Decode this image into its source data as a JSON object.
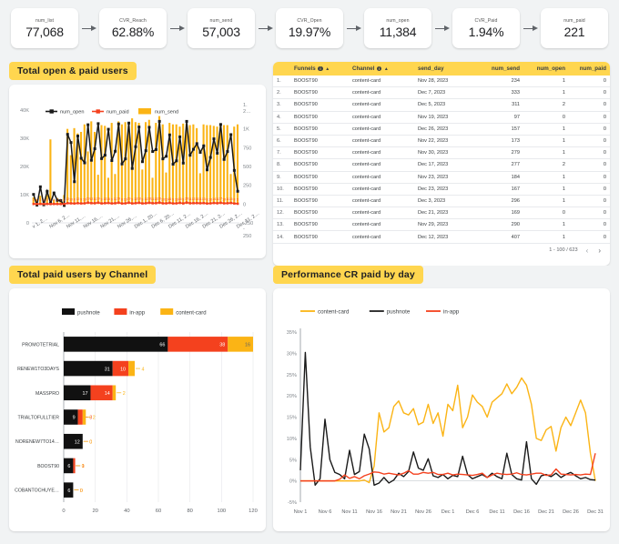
{
  "funnel": {
    "steps": [
      {
        "label": "num_list",
        "value": "77,068"
      },
      {
        "label": "CVR_Reach",
        "value": "62.88%"
      },
      {
        "label": "num_send",
        "value": "57,003"
      },
      {
        "label": "CVR_Open",
        "value": "19.97%"
      },
      {
        "label": "num_open",
        "value": "11,384"
      },
      {
        "label": "CVR_Paid",
        "value": "1.94%"
      },
      {
        "label": "num_paid",
        "value": "221"
      }
    ]
  },
  "panels": {
    "open_paid_title": "Total open & paid users",
    "channel_title": "Total paid users by Channel",
    "cr_title": "Performance CR paid by day"
  },
  "colors": {
    "accent_yellow": "#ffd64f",
    "bar_orange": "#fbb415",
    "line_black": "#1a1a1a",
    "line_red": "#f4411e",
    "in_app": "#f4411e",
    "content_card": "#fbb415",
    "pushnote": "#111111",
    "panel_bg": "#f1f3f4"
  },
  "table": {
    "columns": [
      {
        "key": "idx",
        "label": ""
      },
      {
        "key": "funnels",
        "label": "Funnels",
        "info": true,
        "sort": "▲"
      },
      {
        "key": "channel",
        "label": "Channel",
        "info": true,
        "sort": "▲"
      },
      {
        "key": "send_day",
        "label": "send_day"
      },
      {
        "key": "num_send",
        "label": "num_send"
      },
      {
        "key": "num_open",
        "label": "num_open"
      },
      {
        "key": "num_paid",
        "label": "num_paid"
      }
    ],
    "rows": [
      {
        "idx": "1.",
        "funnels": "BOOST90",
        "channel": "content-card",
        "send_day": "Nov 28, 2023",
        "num_send": "234",
        "num_open": "1",
        "num_paid": "0"
      },
      {
        "idx": "2.",
        "funnels": "BOOST90",
        "channel": "content-card",
        "send_day": "Dec 7, 2023",
        "num_send": "333",
        "num_open": "1",
        "num_paid": "0"
      },
      {
        "idx": "3.",
        "funnels": "BOOST90",
        "channel": "content-card",
        "send_day": "Dec 5, 2023",
        "num_send": "311",
        "num_open": "2",
        "num_paid": "0"
      },
      {
        "idx": "4.",
        "funnels": "BOOST90",
        "channel": "content-card",
        "send_day": "Nov 19, 2023",
        "num_send": "97",
        "num_open": "0",
        "num_paid": "0"
      },
      {
        "idx": "5.",
        "funnels": "BOOST90",
        "channel": "content-card",
        "send_day": "Dec 26, 2023",
        "num_send": "157",
        "num_open": "1",
        "num_paid": "0"
      },
      {
        "idx": "6.",
        "funnels": "BOOST90",
        "channel": "content-card",
        "send_day": "Nov 22, 2023",
        "num_send": "173",
        "num_open": "1",
        "num_paid": "0"
      },
      {
        "idx": "7.",
        "funnels": "BOOST90",
        "channel": "content-card",
        "send_day": "Nov 30, 2023",
        "num_send": "279",
        "num_open": "1",
        "num_paid": "0"
      },
      {
        "idx": "8.",
        "funnels": "BOOST90",
        "channel": "content-card",
        "send_day": "Dec 17, 2023",
        "num_send": "277",
        "num_open": "2",
        "num_paid": "0"
      },
      {
        "idx": "9.",
        "funnels": "BOOST90",
        "channel": "content-card",
        "send_day": "Nov 23, 2023",
        "num_send": "184",
        "num_open": "1",
        "num_paid": "0"
      },
      {
        "idx": "10.",
        "funnels": "BOOST90",
        "channel": "content-card",
        "send_day": "Dec 23, 2023",
        "num_send": "167",
        "num_open": "1",
        "num_paid": "0"
      },
      {
        "idx": "11.",
        "funnels": "BOOST90",
        "channel": "content-card",
        "send_day": "Dec 3, 2023",
        "num_send": "296",
        "num_open": "1",
        "num_paid": "0"
      },
      {
        "idx": "12.",
        "funnels": "BOOST90",
        "channel": "content-card",
        "send_day": "Dec 21, 2023",
        "num_send": "169",
        "num_open": "0",
        "num_paid": "0"
      },
      {
        "idx": "13.",
        "funnels": "BOOST90",
        "channel": "content-card",
        "send_day": "Nov 29, 2023",
        "num_send": "290",
        "num_open": "1",
        "num_paid": "0"
      },
      {
        "idx": "14.",
        "funnels": "BOOST90",
        "channel": "content-card",
        "send_day": "Dec 12, 2023",
        "num_send": "407",
        "num_open": "1",
        "num_paid": "0"
      }
    ],
    "pagination": "1 - 100 / 623",
    "prev_icon": "‹",
    "next_icon": "›"
  },
  "chart_data": [
    {
      "id": "open_paid",
      "type": "line",
      "title": "Total open & paid users",
      "xlabel": "",
      "ylabel": "",
      "legend": [
        {
          "name": "num_open",
          "color": "#1a1a1a",
          "style": "line-marker"
        },
        {
          "name": "num_paid",
          "color": "#f4411e",
          "style": "line-marker"
        },
        {
          "name": "num_send",
          "color": "#fbb415",
          "style": "bar"
        }
      ],
      "legend_position": "top-left",
      "grid": false,
      "y_left_ticks": [
        "0",
        "10K",
        "20K",
        "30K",
        "40K"
      ],
      "ylim_left": [
        0,
        40000
      ],
      "y_right_ticks": [
        "-250",
        "0",
        "250",
        "500",
        "750",
        "1K",
        "1.2…"
      ],
      "ylim_right": [
        -250,
        1250
      ],
      "x_ticks": [
        "v 1, 2…",
        "Nov 6, 2…",
        "Nov 11,…",
        "Nov 16,…",
        "Nov 21,…",
        "Nov 26,…",
        "Dec 1, 20…",
        "Dec 6, 20…",
        "Dec 11, 2…",
        "Dec 16, 2…",
        "Dec 21, 2…",
        "Dec 26, 2…",
        "Dec 31, 2…"
      ],
      "x": [
        "Nov 1",
        "Nov 2",
        "Nov 3",
        "Nov 4",
        "Nov 5",
        "Nov 6",
        "Nov 7",
        "Nov 8",
        "Nov 9",
        "Nov 10",
        "Nov 11",
        "Nov 12",
        "Nov 13",
        "Nov 14",
        "Nov 15",
        "Nov 16",
        "Nov 17",
        "Nov 18",
        "Nov 19",
        "Nov 20",
        "Nov 21",
        "Nov 22",
        "Nov 23",
        "Nov 24",
        "Nov 25",
        "Nov 26",
        "Nov 27",
        "Nov 28",
        "Nov 29",
        "Nov 30",
        "Dec 1",
        "Dec 2",
        "Dec 3",
        "Dec 4",
        "Dec 5",
        "Dec 6",
        "Dec 7",
        "Dec 8",
        "Dec 9",
        "Dec 10",
        "Dec 11",
        "Dec 12",
        "Dec 13",
        "Dec 14",
        "Dec 15",
        "Dec 16",
        "Dec 17",
        "Dec 18",
        "Dec 19",
        "Dec 20",
        "Dec 21",
        "Dec 22",
        "Dec 23",
        "Dec 24",
        "Dec 25",
        "Dec 26",
        "Dec 27",
        "Dec 28",
        "Dec 29",
        "Dec 30",
        "Dec 31"
      ],
      "series": [
        {
          "name": "num_open",
          "axis": "left",
          "color": "#1a1a1a",
          "values": [
            10100,
            6300,
            12800,
            6400,
            11200,
            7000,
            10600,
            8000,
            7900,
            6200,
            31400,
            28500,
            14600,
            30800,
            22900,
            21300,
            34800,
            22200,
            26300,
            35200,
            22800,
            24000,
            33200,
            22100,
            25400,
            35100,
            20900,
            22700,
            35400,
            19300,
            27000,
            34000,
            21700,
            25600,
            33900,
            25300,
            26000,
            36000,
            22700,
            23600,
            31200,
            20800,
            22000,
            30500,
            21200,
            36000,
            24000,
            26100,
            28100,
            25000,
            27300,
            18800,
            23200,
            29800,
            24700,
            34900,
            22500,
            25300,
            31300,
            18600,
            11200
          ]
        },
        {
          "name": "num_paid",
          "axis": "right",
          "color": "#f4411e",
          "values": [
            2,
            1,
            2,
            1,
            2,
            1,
            2,
            1,
            1,
            1,
            12,
            10,
            8,
            12,
            9,
            10,
            19,
            12,
            11,
            19,
            9,
            12,
            15,
            9,
            11,
            19,
            8,
            10,
            19,
            9,
            12,
            18,
            9,
            11,
            18,
            11,
            12,
            20,
            10,
            10,
            16,
            9,
            10,
            16,
            9,
            20,
            11,
            12,
            13,
            11,
            13,
            8,
            10,
            14,
            11,
            17,
            10,
            11,
            15,
            8,
            5
          ]
        },
        {
          "name": "num_send",
          "axis": "right",
          "color": "#fbb415",
          "values": [
            90,
            60,
            110,
            20,
            120,
            860,
            60,
            80,
            50,
            120,
            1000,
            650,
            1010,
            940,
            960,
            1060,
            700,
            1100,
            960,
            390,
            1050,
            1040,
            350,
            1080,
            400,
            1100,
            1060,
            1090,
            1050,
            1140,
            1090,
            1080,
            460,
            1090,
            1120,
            350,
            1080,
            1170,
            1060,
            420,
            1080,
            1060,
            1060,
            1030,
            1070,
            1070,
            1050,
            1060,
            1010,
            410,
            1060,
            1050,
            1050,
            1040,
            1030,
            1060,
            1050,
            1050,
            400,
            1030,
            1060
          ]
        }
      ]
    },
    {
      "id": "paid_by_channel",
      "type": "bar",
      "orientation": "horizontal",
      "stacked": true,
      "title": "Total paid users by Channel",
      "xlabel": "",
      "ylabel": "",
      "grid": true,
      "legend_position": "top-center",
      "legend": [
        {
          "name": "pushnote",
          "color": "#111111"
        },
        {
          "name": "in-app",
          "color": "#f4411e"
        },
        {
          "name": "content-card",
          "color": "#fbb415"
        }
      ],
      "xlim": [
        0,
        120
      ],
      "x_ticks": [
        "0",
        "20",
        "40",
        "60",
        "80",
        "100",
        "120"
      ],
      "categories": [
        "PROMOTETRIAL",
        "RENEW1TO3DAYS",
        "MASSPRO",
        "TRIALTOFULLTIER",
        "NORENEW7TO14…",
        "BOOST90",
        "COBANTOCHUYE…"
      ],
      "series": [
        {
          "name": "pushnote",
          "color": "#111111",
          "values": [
            66,
            31,
            17,
            9,
            12,
            6,
            6
          ]
        },
        {
          "name": "in-app",
          "color": "#f4411e",
          "values": [
            38,
            10,
            14,
            3,
            0,
            1,
            0
          ]
        },
        {
          "name": "content-card",
          "color": "#fbb415",
          "values": [
            16,
            4,
            2,
            2,
            0,
            0,
            0
          ]
        }
      ]
    },
    {
      "id": "cr_paid_by_day",
      "type": "line",
      "title": "Performance CR paid by day",
      "xlabel": "",
      "ylabel": "",
      "grid": false,
      "legend_position": "top-left",
      "legend": [
        {
          "name": "content-card",
          "color": "#fbb415"
        },
        {
          "name": "pushnote",
          "color": "#1a1a1a"
        },
        {
          "name": "in-app",
          "color": "#f4411e"
        }
      ],
      "ylim": [
        -5,
        35
      ],
      "y_ticks": [
        "-5%",
        "0%",
        "5%",
        "10%",
        "15%",
        "20%",
        "25%",
        "30%",
        "35%"
      ],
      "x_ticks": [
        "Nov 1",
        "Nov 6",
        "Nov 11",
        "Nov 16",
        "Nov 21",
        "Nov 26",
        "Dec 1",
        "Dec 6",
        "Dec 11",
        "Dec 16",
        "Dec 21",
        "Dec 26",
        "Dec 31"
      ],
      "x": [
        "Nov 1",
        "Nov 2",
        "Nov 3",
        "Nov 4",
        "Nov 5",
        "Nov 6",
        "Nov 7",
        "Nov 8",
        "Nov 9",
        "Nov 10",
        "Nov 11",
        "Nov 12",
        "Nov 13",
        "Nov 14",
        "Nov 15",
        "Nov 16",
        "Nov 17",
        "Nov 18",
        "Nov 19",
        "Nov 20",
        "Nov 21",
        "Nov 22",
        "Nov 23",
        "Nov 24",
        "Nov 25",
        "Nov 26",
        "Nov 27",
        "Nov 28",
        "Nov 29",
        "Nov 30",
        "Dec 1",
        "Dec 2",
        "Dec 3",
        "Dec 4",
        "Dec 5",
        "Dec 6",
        "Dec 7",
        "Dec 8",
        "Dec 9",
        "Dec 10",
        "Dec 11",
        "Dec 12",
        "Dec 13",
        "Dec 14",
        "Dec 15",
        "Dec 16",
        "Dec 17",
        "Dec 18",
        "Dec 19",
        "Dec 20",
        "Dec 21",
        "Dec 22",
        "Dec 23",
        "Dec 24",
        "Dec 25",
        "Dec 26",
        "Dec 27",
        "Dec 28",
        "Dec 29",
        "Dec 30",
        "Dec 31"
      ],
      "series": [
        {
          "name": "content-card",
          "color": "#fbb415",
          "values": [
            0,
            0,
            0,
            0,
            0,
            0,
            0,
            0,
            0,
            0,
            0,
            0,
            0,
            0.2,
            -0.4,
            3.5,
            16,
            11.5,
            12.5,
            17.5,
            18.8,
            16,
            15.5,
            17,
            13.2,
            13.8,
            18,
            13.5,
            16,
            10.5,
            18,
            16.5,
            22.5,
            12.5,
            15,
            20.2,
            18.5,
            17.5,
            15,
            18.5,
            19.5,
            20.5,
            22.8,
            20.5,
            22,
            24.2,
            22.5,
            18,
            10,
            9.5,
            12,
            12.8,
            7,
            12.5,
            15,
            13,
            16,
            19,
            16,
            6.5,
            0
          ]
        },
        {
          "name": "pushnote",
          "color": "#1a1a1a",
          "values": [
            2.5,
            30.2,
            8,
            -1,
            0.5,
            14.5,
            5,
            2,
            1.5,
            0.5,
            7.2,
            1.5,
            2.2,
            11,
            7.5,
            -1,
            -0.5,
            0.8,
            -0.5,
            0.2,
            1.8,
            1,
            2.2,
            6.8,
            3,
            2.5,
            5.2,
            1.2,
            0.8,
            1.5,
            0.5,
            1.3,
            1,
            5.8,
            1.5,
            0.5,
            1,
            1.5,
            0.8,
            1.8,
            1,
            0.5,
            6.5,
            1.5,
            0.5,
            0.2,
            9.2,
            0.5,
            -0.8,
            1.2,
            1.5,
            1,
            1.8,
            0.8,
            1.5,
            2,
            1.2,
            0.5,
            0.8,
            0.3,
            0.2
          ]
        },
        {
          "name": "in-app",
          "color": "#f4411e",
          "values": [
            0,
            0,
            0,
            0,
            0,
            0,
            0,
            0,
            0.4,
            1.4,
            0.6,
            1,
            0.5,
            1.2,
            1.6,
            2.1,
            2,
            1.6,
            1.8,
            1.6,
            1.4,
            1.8,
            2.4,
            1.6,
            1.6,
            2,
            1.8,
            2,
            1.5,
            1.5,
            1.8,
            1.4,
            1.6,
            1.5,
            1.4,
            1.3,
            1.5,
            1.8,
            0.8,
            1.4,
            1.8,
            1.6,
            1.5,
            1.6,
            1.9,
            1.5,
            1.4,
            1.6,
            1.8,
            1.8,
            1.3,
            1.4,
            2.8,
            1.6,
            1.5,
            1.4,
            1.5,
            1.4,
            1.6,
            1.5,
            6.5
          ]
        }
      ]
    }
  ]
}
